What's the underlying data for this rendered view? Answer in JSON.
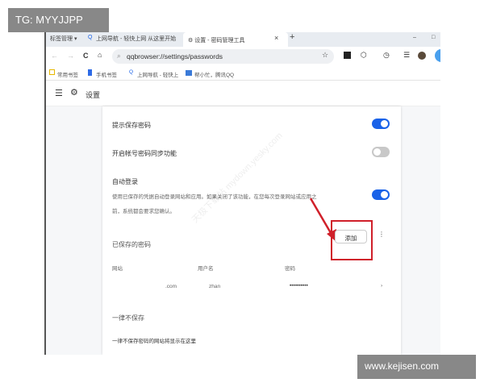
{
  "overlay": {
    "tg": "TG: MYYJJPP",
    "site": "www.kejisen.com"
  },
  "tabs": [
    {
      "label": "标签管理 ▾"
    },
    {
      "label": "上网导航 - 轻快上网 从这里开始"
    },
    {
      "label": "设置 - 密码管理工具"
    }
  ],
  "tab_controls": {
    "close": "×",
    "new": "+",
    "min": "–",
    "max": "□"
  },
  "address": {
    "url": "qqbrowser://settings/passwords"
  },
  "nav": {
    "back": "←",
    "forward": "→",
    "reload": "C",
    "home": "⌂",
    "star": "☆",
    "menu": "☰"
  },
  "bookmarks": [
    "常用书签",
    "手机书签",
    "上网导航 - 轻快上",
    "帮小忙，腾讯QQ"
  ],
  "header": {
    "title": "设置"
  },
  "settings": {
    "offer_save": {
      "label": "提示保存密码",
      "enabled": true
    },
    "sync": {
      "label": "开启帐号密码同步功能",
      "enabled": false
    },
    "auto_login": {
      "label": "自动登录",
      "desc1": "使用已保存的凭据自动登录网站和应用。如果关闭了该功能，在您每次登录网站或应用之",
      "desc2": "前，系统都会要求您确认。",
      "enabled": true
    }
  },
  "saved": {
    "title": "已保存的密码",
    "add": "添加",
    "more": "⋮",
    "columns": [
      "网站",
      "用户名",
      "密码"
    ],
    "rows": [
      {
        "site": ".com",
        "user": "zhan",
        "password": "••••••••••"
      }
    ]
  },
  "never": {
    "title": "一律不保存",
    "empty": "一律不保存密码的网站将显示在这里"
  },
  "watermark": "天极下载站 mydown.yesky.com",
  "colors": {
    "accent": "#1a62e8",
    "highlight": "#d0202a"
  }
}
